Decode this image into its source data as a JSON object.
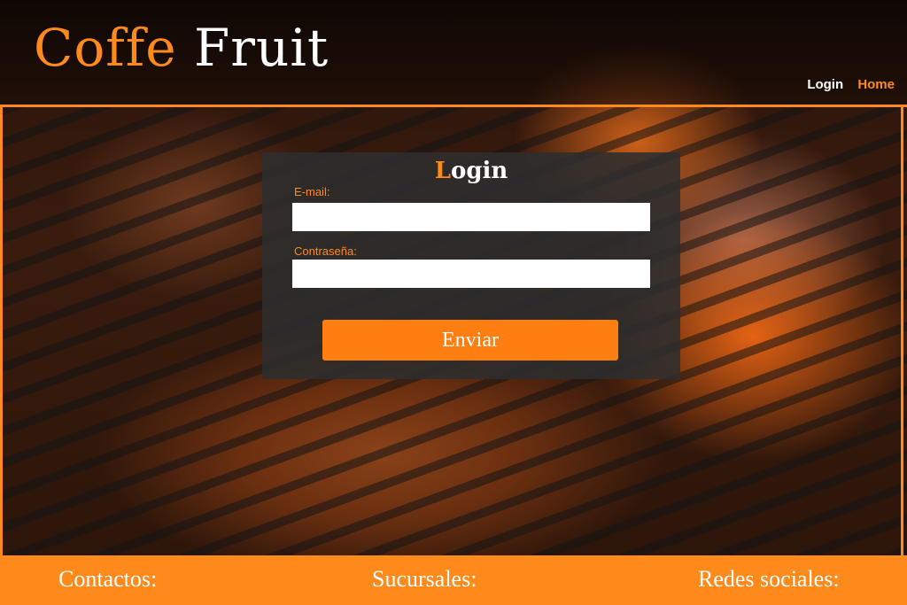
{
  "header": {
    "logo_word1": "Coffe",
    "logo_word2": "Fruit",
    "nav": {
      "login": "Login",
      "home": "Home"
    }
  },
  "login_panel": {
    "title_first_letter": "L",
    "title_rest": "ogin",
    "email_label": "E-mail:",
    "email_value": "",
    "password_label": "Contraseña:",
    "password_value": "",
    "submit_label": "Enviar"
  },
  "footer": {
    "contacts": "Contactos:",
    "branches": "Sucursales:",
    "social": "Redes sociales:"
  },
  "colors": {
    "accent": "#ff8a1c",
    "panel": "#2d2d2d",
    "text": "#ffffff"
  }
}
